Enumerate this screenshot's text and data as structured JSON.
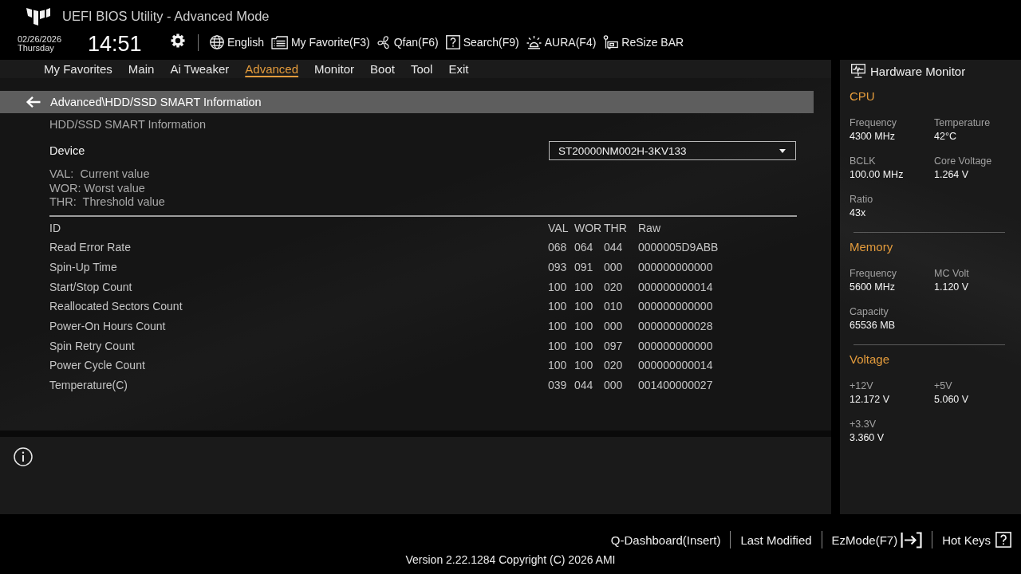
{
  "header": {
    "title": "UEFI BIOS Utility - Advanced Mode",
    "date": "02/26/2026",
    "day": "Thursday",
    "time": "14:51",
    "toolbar": [
      {
        "kind": "language",
        "label": "English"
      },
      {
        "kind": "favorite",
        "label": "My Favorite(F3)"
      },
      {
        "kind": "fan",
        "label": "Qfan(F6)"
      },
      {
        "kind": "search",
        "label": "Search(F9)"
      },
      {
        "kind": "aura",
        "label": "AURA(F4)"
      },
      {
        "kind": "resize",
        "label": "ReSize BAR"
      }
    ]
  },
  "tabs": [
    {
      "label": "My Favorites",
      "selected": false
    },
    {
      "label": "Main",
      "selected": false
    },
    {
      "label": "Ai Tweaker",
      "selected": false
    },
    {
      "label": "Advanced",
      "selected": true
    },
    {
      "label": "Monitor",
      "selected": false
    },
    {
      "label": "Boot",
      "selected": false
    },
    {
      "label": "Tool",
      "selected": false
    },
    {
      "label": "Exit",
      "selected": false
    }
  ],
  "breadcrumb": "Advanced\\HDD/SSD SMART Information",
  "section_title": "HDD/SSD SMART Information",
  "device": {
    "label": "Device",
    "value": "ST20000NM002H-3KV133"
  },
  "legend": [
    "VAL:  Current value",
    "WOR: Worst value",
    "THR:  Threshold value"
  ],
  "table": {
    "columns": [
      "ID",
      "VAL",
      "WOR",
      "THR",
      "Raw"
    ],
    "rows": [
      {
        "id": "Read Error Rate",
        "val": "068",
        "wor": "064",
        "thr": "044",
        "raw": "0000005D9ABB"
      },
      {
        "id": "Spin-Up Time",
        "val": "093",
        "wor": "091",
        "thr": "000",
        "raw": "000000000000"
      },
      {
        "id": "Start/Stop Count",
        "val": "100",
        "wor": "100",
        "thr": "020",
        "raw": "000000000014"
      },
      {
        "id": "Reallocated Sectors Count",
        "val": "100",
        "wor": "100",
        "thr": "010",
        "raw": "000000000000"
      },
      {
        "id": "Power-On Hours Count",
        "val": "100",
        "wor": "100",
        "thr": "000",
        "raw": "000000000028"
      },
      {
        "id": "Spin Retry Count",
        "val": "100",
        "wor": "100",
        "thr": "097",
        "raw": "000000000000"
      },
      {
        "id": "Power Cycle Count",
        "val": "100",
        "wor": "100",
        "thr": "020",
        "raw": "000000000014"
      },
      {
        "id": "Temperature(C)",
        "val": "039",
        "wor": "044",
        "thr": "000",
        "raw": "001400000027"
      }
    ]
  },
  "hardware_monitor": {
    "title": "Hardware Monitor",
    "sections": [
      {
        "title": "CPU",
        "items": [
          {
            "label": "Frequency",
            "value": "4300 MHz"
          },
          {
            "label": "Temperature",
            "value": "42°C"
          },
          {
            "label": "BCLK",
            "value": "100.00 MHz"
          },
          {
            "label": "Core Voltage",
            "value": "1.264 V"
          },
          {
            "label": "Ratio",
            "value": "43x"
          }
        ]
      },
      {
        "title": "Memory",
        "items": [
          {
            "label": "Frequency",
            "value": "5600 MHz"
          },
          {
            "label": "MC Volt",
            "value": "1.120 V"
          },
          {
            "label": "Capacity",
            "value": "65536 MB"
          }
        ]
      },
      {
        "title": "Voltage",
        "items": [
          {
            "label": "+12V",
            "value": "12.172 V"
          },
          {
            "label": "+5V",
            "value": "5.060 V"
          },
          {
            "label": "+3.3V",
            "value": "3.360 V"
          }
        ]
      }
    ]
  },
  "footer": {
    "links": [
      {
        "kind": "plain",
        "label": "Q-Dashboard(Insert)"
      },
      {
        "kind": "plain",
        "label": "Last Modified"
      },
      {
        "kind": "ezmode",
        "label": "EzMode(F7)"
      },
      {
        "kind": "hotkeys",
        "label": "Hot Keys"
      }
    ],
    "version": "Version 2.22.1284 Copyright (C) 2026 AMI"
  }
}
